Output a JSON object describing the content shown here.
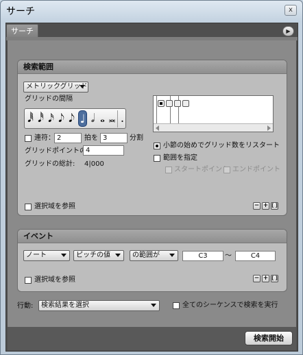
{
  "window": {
    "title": "サーチ",
    "close_label": "x"
  },
  "tab": {
    "label": "サーチ"
  },
  "search_range": {
    "header": "検索範囲",
    "mode_dropdown": "メトリックグリッド",
    "grid_interval_label": "グリッドの間隔",
    "notes": [
      "𝅘𝅥𝅱",
      "𝅘𝅥𝅰",
      "𝅘𝅥𝅯",
      "𝅘𝅥𝅮",
      "𝅘𝅥𝅮",
      "♩",
      "𝅗𝅥",
      "𝅝",
      "𝅜",
      "."
    ],
    "selected_note_index": 5,
    "tuplet_label": "連符：",
    "tuplet_value": "2",
    "beats_label": "拍を",
    "beats_value": "3",
    "division_label": "分割",
    "grid_points_label": "グリッドポイントの数:",
    "grid_points_value": "4",
    "grid_total_label": "グリッドの総計:",
    "grid_total_value": "4|000",
    "restart_label": "小節の始めでグリッド数をリスタート",
    "restart_checked": true,
    "range_label": "範囲を指定",
    "range_checked": false,
    "start_point_label": "スタートポイント",
    "end_point_label": "エンドポイント",
    "ref_selection_label": "選択域を参照",
    "plus_minus": [
      "−",
      "+",
      "[ ]"
    ]
  },
  "event": {
    "header": "イベント",
    "type_dropdown": "ノート",
    "property_dropdown": "ピッチの値",
    "condition_dropdown": "の範囲が",
    "from_value": "C3",
    "tilde": "〜",
    "to_value": "C4",
    "ref_selection_label": "選択域を参照",
    "plus_minus": [
      "−",
      "+",
      "[ ]"
    ]
  },
  "action": {
    "label": "行動:",
    "dropdown": "検索結果を選択",
    "all_sequences_label": "全てのシーケンスで検索を実行",
    "all_sequences_checked": false
  },
  "search_button": "検索開始"
}
